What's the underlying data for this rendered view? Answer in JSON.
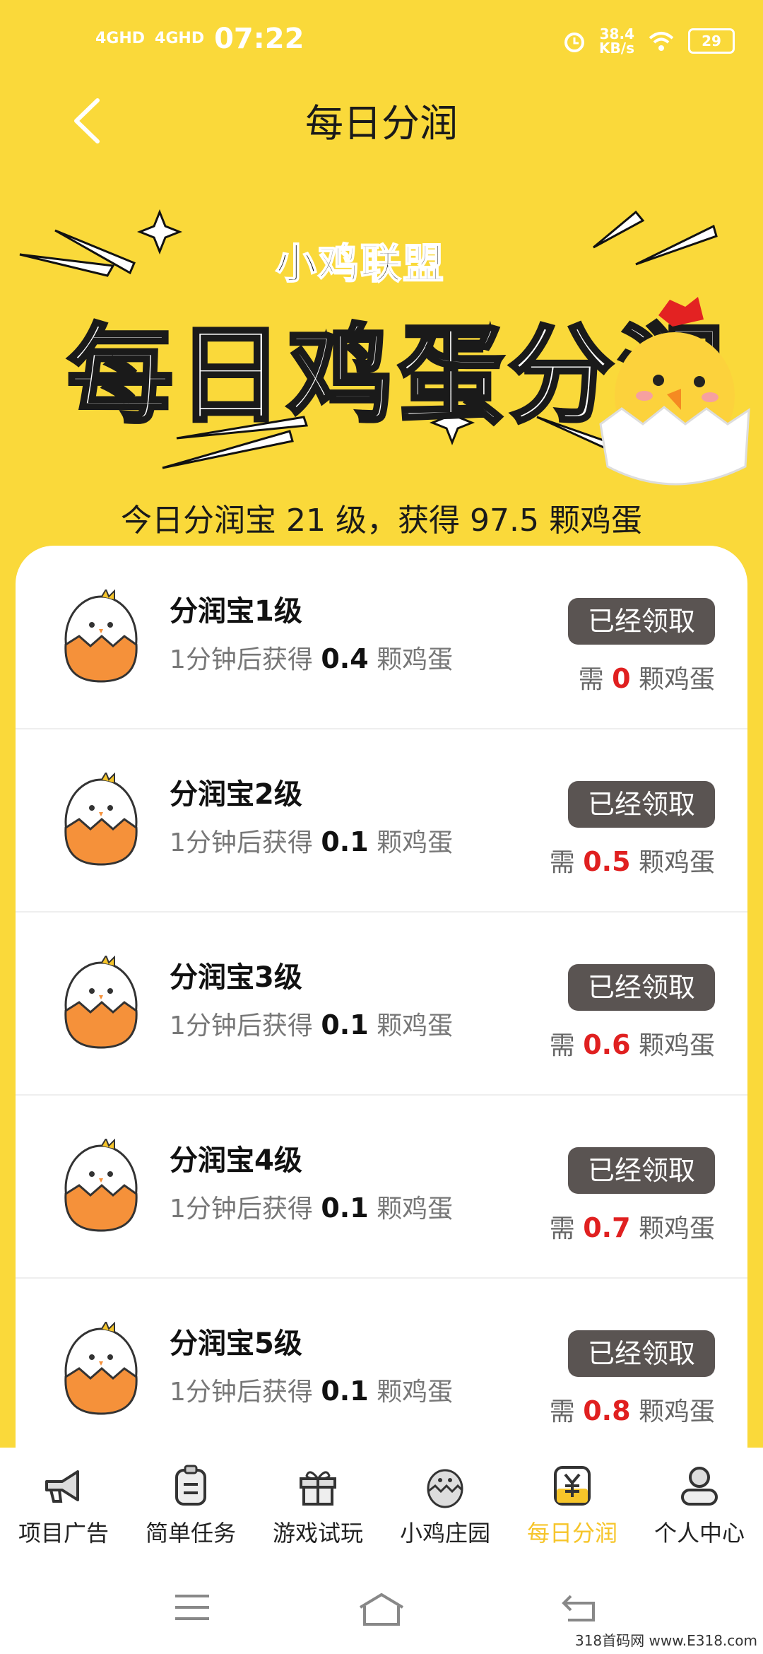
{
  "status_bar": {
    "signal1": "4GHD",
    "signal2": "4GHD",
    "time": "07:22",
    "speed_value": "38.4",
    "speed_unit": "KB/s",
    "battery": "29"
  },
  "header": {
    "title": "每日分润"
  },
  "banner": {
    "sub_title": "小鸡联盟",
    "main_title": "每日鸡蛋分润",
    "summary": "今日分润宝 21 级，获得 97.5 颗鸡蛋"
  },
  "rows": [
    {
      "name": "分润宝1级",
      "desc_prefix": "1分钟后获得",
      "amount": "0.4",
      "desc_suffix": "颗鸡蛋",
      "button": "已经领取",
      "need_prefix": "需",
      "need_value": "0",
      "need_suffix": "颗鸡蛋"
    },
    {
      "name": "分润宝2级",
      "desc_prefix": "1分钟后获得",
      "amount": "0.1",
      "desc_suffix": "颗鸡蛋",
      "button": "已经领取",
      "need_prefix": "需",
      "need_value": "0.5",
      "need_suffix": "颗鸡蛋"
    },
    {
      "name": "分润宝3级",
      "desc_prefix": "1分钟后获得",
      "amount": "0.1",
      "desc_suffix": "颗鸡蛋",
      "button": "已经领取",
      "need_prefix": "需",
      "need_value": "0.6",
      "need_suffix": "颗鸡蛋"
    },
    {
      "name": "分润宝4级",
      "desc_prefix": "1分钟后获得",
      "amount": "0.1",
      "desc_suffix": "颗鸡蛋",
      "button": "已经领取",
      "need_prefix": "需",
      "need_value": "0.7",
      "need_suffix": "颗鸡蛋"
    },
    {
      "name": "分润宝5级",
      "desc_prefix": "1分钟后获得",
      "amount": "0.1",
      "desc_suffix": "颗鸡蛋",
      "button": "已经领取",
      "need_prefix": "需",
      "need_value": "0.8",
      "need_suffix": "颗鸡蛋"
    }
  ],
  "tabs": [
    {
      "label": "项目广告",
      "icon": "megaphone-icon"
    },
    {
      "label": "简单任务",
      "icon": "clipboard-icon"
    },
    {
      "label": "游戏试玩",
      "icon": "gift-box-icon"
    },
    {
      "label": "小鸡庄园",
      "icon": "chick-egg-icon"
    },
    {
      "label": "每日分润",
      "icon": "yuan-icon",
      "active": true
    },
    {
      "label": "个人中心",
      "icon": "user-icon"
    }
  ],
  "colors": {
    "background": "#FAD93A",
    "accent_tab": "#F6C52A",
    "red": "#E02020",
    "button": "#5A5452",
    "egg": "#F5913A"
  },
  "watermark": "318首码网  www.E318.com"
}
